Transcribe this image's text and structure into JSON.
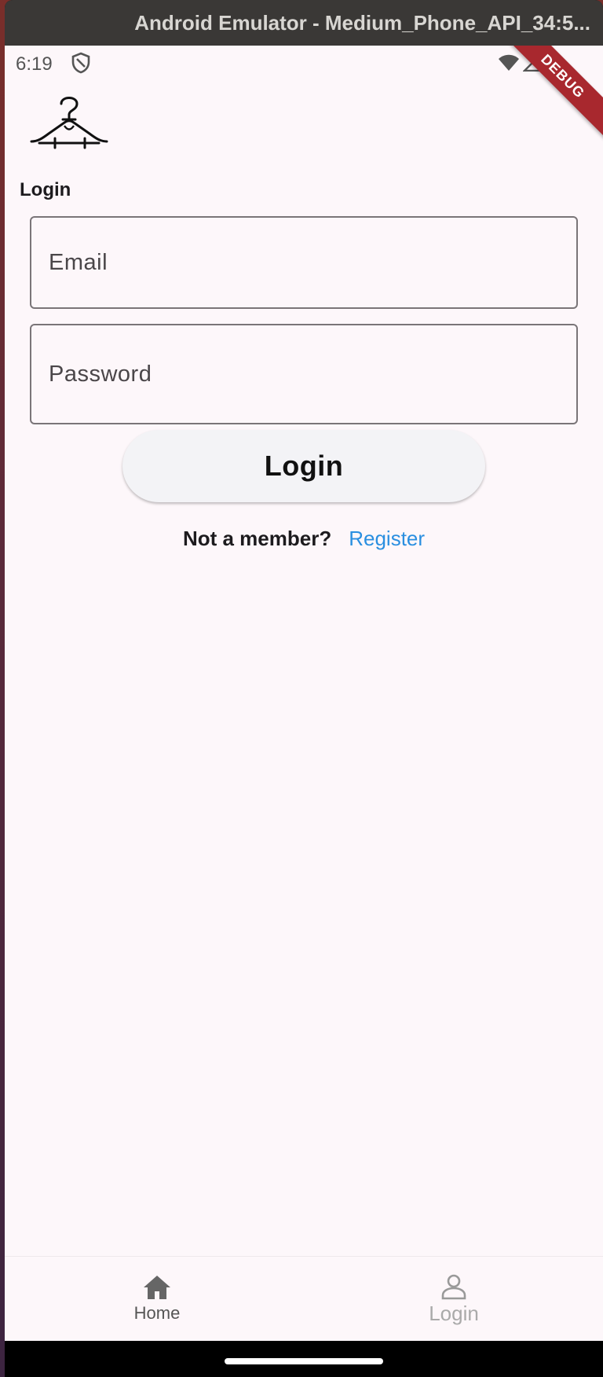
{
  "window": {
    "title": "Android Emulator - Medium_Phone_API_34:5..."
  },
  "statusbar": {
    "time": "6:19"
  },
  "debug_banner": "DEBUG",
  "page": {
    "title": "Login"
  },
  "form": {
    "email_placeholder": "Email",
    "password_placeholder": "Password",
    "login_button": "Login"
  },
  "register": {
    "question": "Not a member?",
    "link": "Register"
  },
  "bottom_nav": {
    "items": [
      {
        "label": "Home",
        "icon": "home-icon",
        "active": true
      },
      {
        "label": "Login",
        "icon": "person-icon",
        "active": false
      }
    ]
  },
  "colors": {
    "accent_link": "#2a8fe0",
    "background": "#fdf7fa",
    "debug_red": "#a8282e"
  }
}
